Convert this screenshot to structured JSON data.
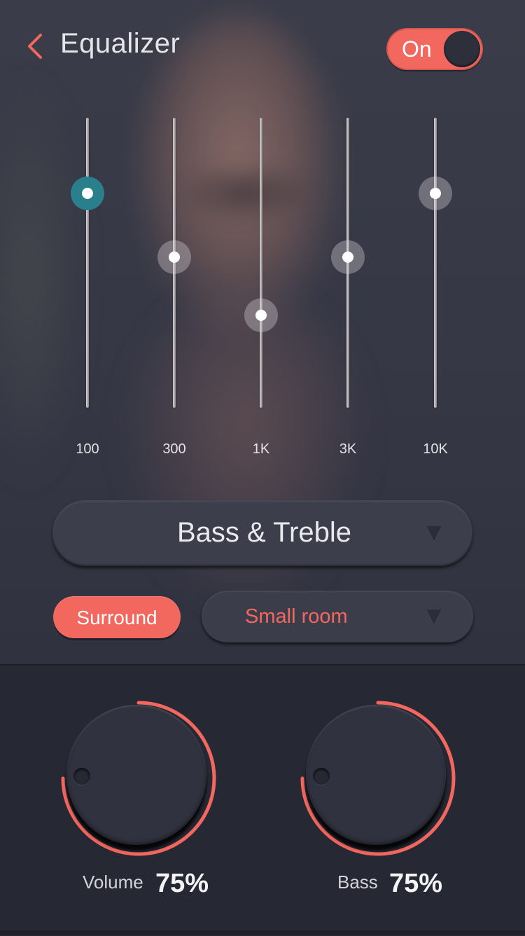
{
  "header": {
    "title": "Equalizer",
    "toggle_label": "On",
    "toggle_on": true
  },
  "equalizer": {
    "bands": [
      {
        "label": "100",
        "level": 0.74,
        "active": true
      },
      {
        "label": "300",
        "level": 0.52,
        "active": false
      },
      {
        "label": "1K",
        "level": 0.32,
        "active": false
      },
      {
        "label": "3K",
        "level": 0.52,
        "active": false
      },
      {
        "label": "10K",
        "level": 0.74,
        "active": false
      }
    ]
  },
  "preset": {
    "selected": "Bass & Treble"
  },
  "surround": {
    "label": "Surround",
    "enabled": true
  },
  "room": {
    "selected": "Small room"
  },
  "knobs": {
    "volume": {
      "label": "Volume",
      "value": "75%",
      "fraction": 0.75
    },
    "bass": {
      "label": "Bass",
      "value": "75%",
      "fraction": 0.75
    }
  },
  "colors": {
    "accent": "#f2675e",
    "active_thumb": "#2a7f8c",
    "panel": "#262834",
    "text": "#e4e5ea"
  },
  "icons": {
    "back": "chevron-left-icon",
    "dropdown": "triangle-down-icon"
  }
}
